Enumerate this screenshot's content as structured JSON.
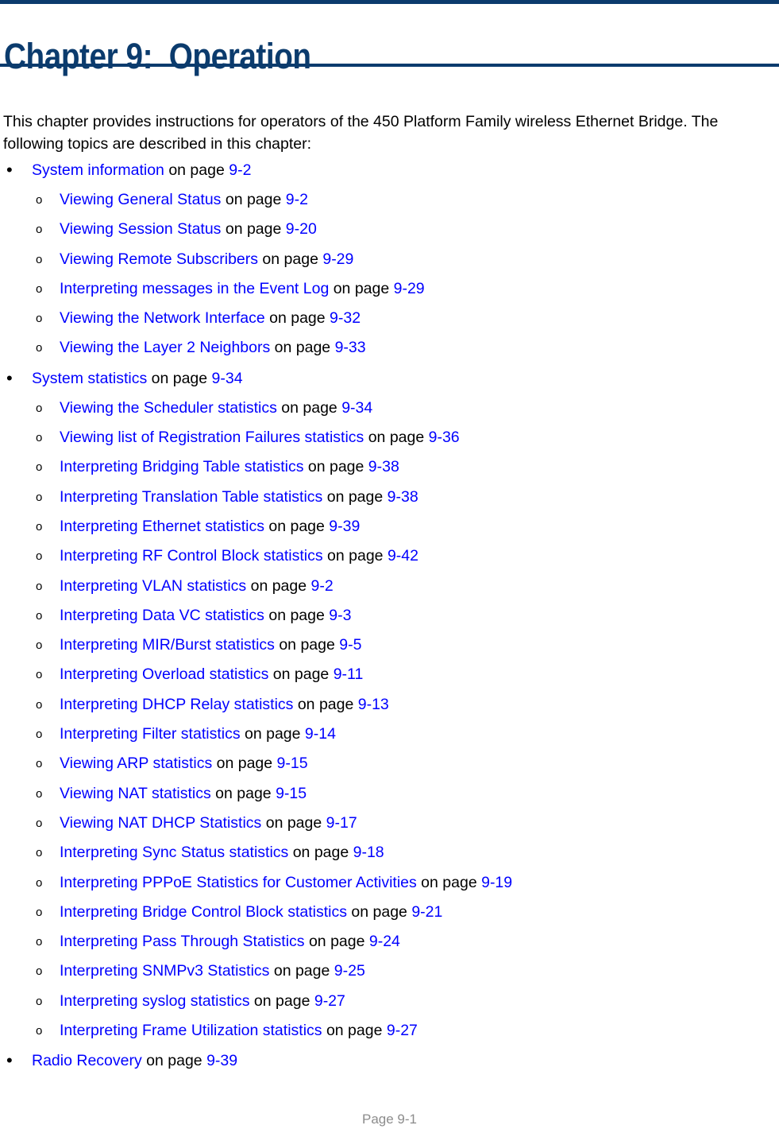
{
  "header": {
    "title": "Chapter 9:  Operation",
    "rule_color": "#0b3b6d"
  },
  "intro": {
    "text": "This chapter provides instructions for operators of the 450 Platform Family wireless Ethernet Bridge. The following topics are described in this chapter:"
  },
  "link_color": "#0000ff",
  "on_page_label": "on page",
  "toc": [
    {
      "level": 1,
      "marker": "•",
      "title": "System information",
      "connector": " on page ",
      "page": "9-2"
    },
    {
      "level": 2,
      "marker": "o",
      "title": "Viewing General Status",
      "connector": " on page ",
      "page": "9-2"
    },
    {
      "level": 2,
      "marker": "o",
      "title": "Viewing Session Status",
      "connector": " on page ",
      "page": "9-20"
    },
    {
      "level": 2,
      "marker": "o",
      "title": "Viewing Remote Subscribers",
      "connector": " on page ",
      "page": "9-29"
    },
    {
      "level": 2,
      "marker": "o",
      "title": "Interpreting messages in the Event Log",
      "connector": " on page ",
      "page": "9-29"
    },
    {
      "level": 2,
      "marker": "o",
      "title": "Viewing the Network Interface",
      "connector": " on page ",
      "page": "9-32"
    },
    {
      "level": 2,
      "marker": "o",
      "title": "Viewing the Layer 2 Neighbors",
      "connector": " on page ",
      "page": "9-33"
    },
    {
      "level": 1,
      "marker": "•",
      "title": "System statistics",
      "connector": " on page ",
      "page": "9-34"
    },
    {
      "level": 2,
      "marker": "o",
      "title": "Viewing the Scheduler statistics",
      "connector": " on page ",
      "page": "9-34"
    },
    {
      "level": 2,
      "marker": "o",
      "title": "Viewing list of Registration Failures statistics",
      "connector": " on page ",
      "page": "9-36"
    },
    {
      "level": 2,
      "marker": "o",
      "title": "Interpreting Bridging Table statistics",
      "connector": " on page ",
      "page": "9-38"
    },
    {
      "level": 2,
      "marker": "o",
      "title": "Interpreting Translation Table statistics",
      "connector": " on page ",
      "page": "9-38"
    },
    {
      "level": 2,
      "marker": "o",
      "title": "Interpreting Ethernet statistics",
      "connector": " on page ",
      "page": "9-39"
    },
    {
      "level": 2,
      "marker": "o",
      "title": "Interpreting RF Control Block statistics",
      "connector": " on page ",
      "page": "9-42"
    },
    {
      "level": 2,
      "marker": "o",
      "title": "Interpreting VLAN statistics",
      "connector": " on page ",
      "page": "9-2"
    },
    {
      "level": 2,
      "marker": "o",
      "title": "Interpreting Data VC statistics",
      "connector": " on page ",
      "page": "9-3"
    },
    {
      "level": 2,
      "marker": "o",
      "title": "Interpreting MIR/Burst statistics",
      "connector": " on page ",
      "page": "9-5"
    },
    {
      "level": 2,
      "marker": "o",
      "title": "Interpreting Overload statistics",
      "connector": " on page ",
      "page": "9-11"
    },
    {
      "level": 2,
      "marker": "o",
      "title": "Interpreting DHCP Relay statistics",
      "connector": " on page ",
      "page": "9-13"
    },
    {
      "level": 2,
      "marker": "o",
      "title": "Interpreting Filter statistics",
      "connector": " on page ",
      "page": "9-14"
    },
    {
      "level": 2,
      "marker": "o",
      "title": "Viewing ARP statistics",
      "connector": " on page ",
      "page": "9-15"
    },
    {
      "level": 2,
      "marker": "o",
      "title": "Viewing NAT statistics",
      "connector": " on page ",
      "page": "9-15"
    },
    {
      "level": 2,
      "marker": "o",
      "title": "Viewing NAT DHCP Statistics",
      "connector": " on page ",
      "page": "9-17"
    },
    {
      "level": 2,
      "marker": "o",
      "title": "Interpreting Sync Status statistics",
      "connector": " on page ",
      "page": "9-18"
    },
    {
      "level": 2,
      "marker": "o",
      "title": "Interpreting PPPoE Statistics for Customer Activities",
      "connector": " on page ",
      "page": "9-19"
    },
    {
      "level": 2,
      "marker": "o",
      "title": "Interpreting Bridge Control Block statistics",
      "connector": " on page ",
      "page": "9-21"
    },
    {
      "level": 2,
      "marker": "o",
      "title": "Interpreting Pass Through Statistics",
      "connector": " on page ",
      "page": "9-24"
    },
    {
      "level": 2,
      "marker": "o",
      "title": "Interpreting SNMPv3 Statistics",
      "connector": " on page ",
      "page": "9-25"
    },
    {
      "level": 2,
      "marker": "o",
      "title": "Interpreting syslog statistics",
      "connector": " on page ",
      "page": "9-27"
    },
    {
      "level": 2,
      "marker": "o",
      "title": "Interpreting Frame Utilization statistics",
      "connector": " on page ",
      "page": "9-27"
    },
    {
      "level": 1,
      "marker": "•",
      "title": "Radio Recovery ",
      "connector": " on page ",
      "page": "9-39"
    }
  ],
  "footer": {
    "page_label": "Page 9-1"
  }
}
